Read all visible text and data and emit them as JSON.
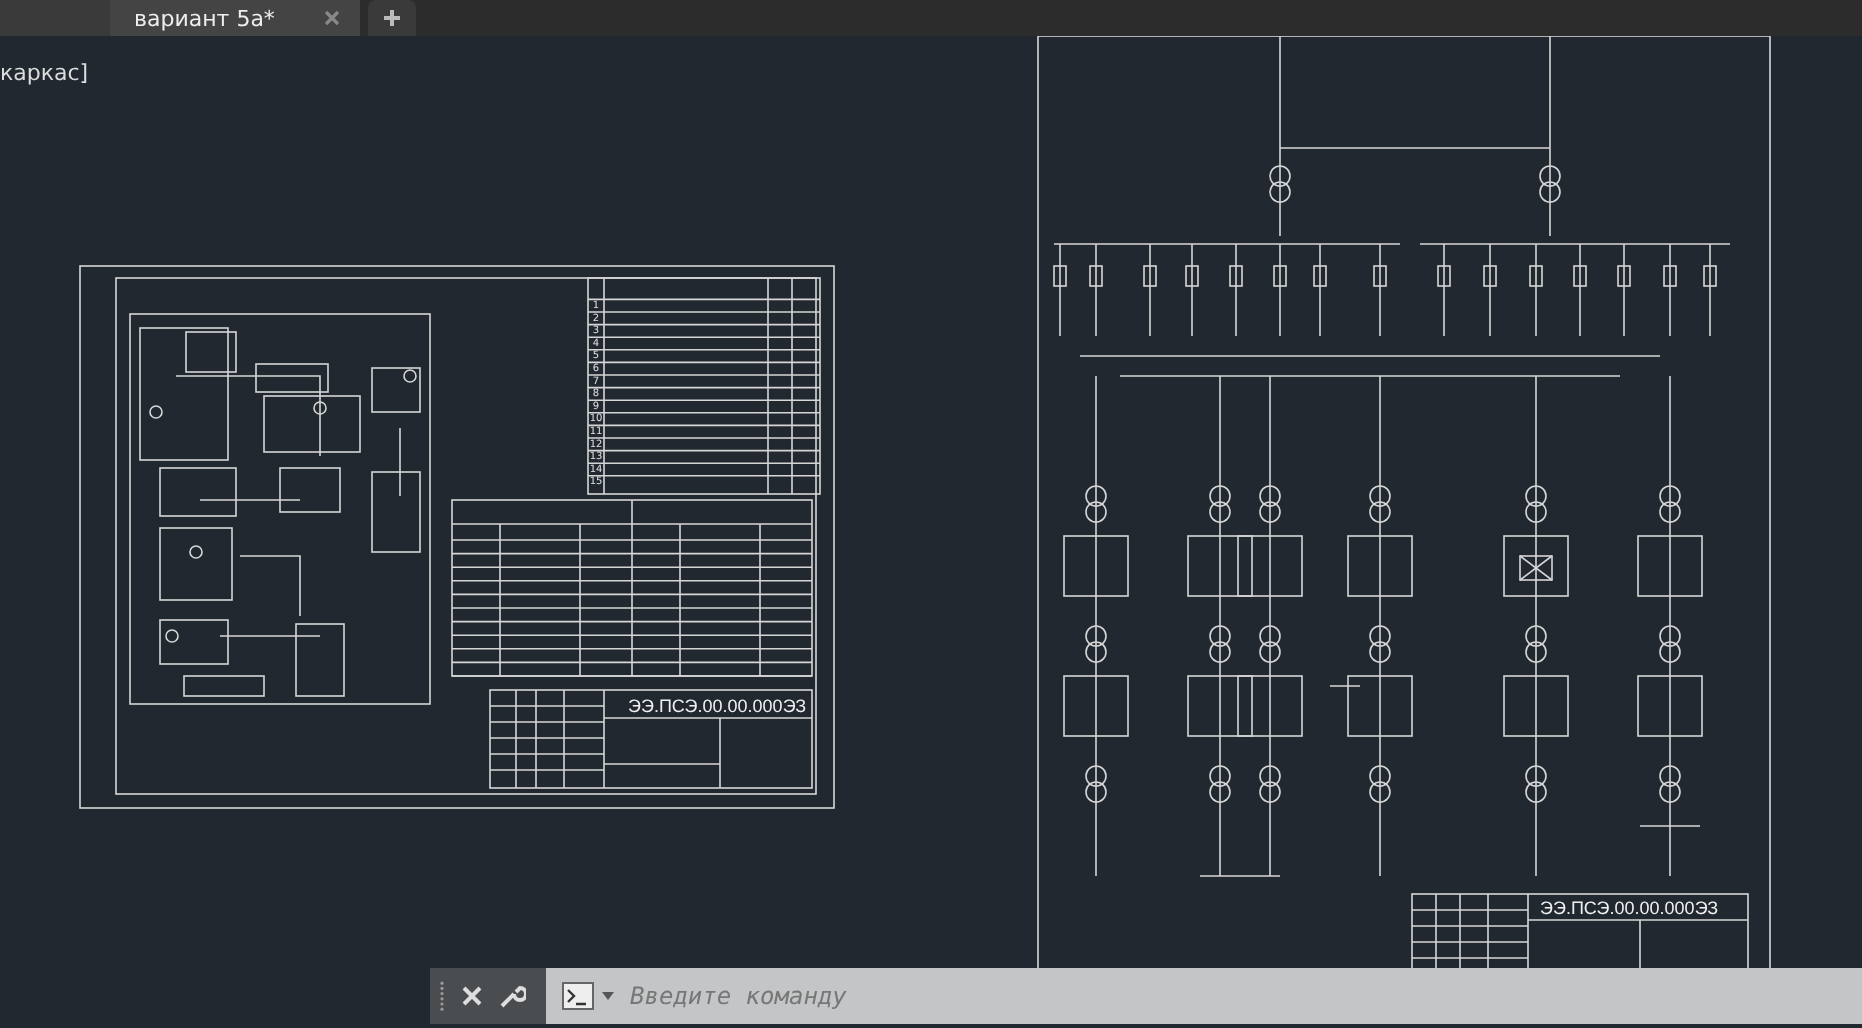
{
  "tabs": [
    {
      "label": "вариант 5а*",
      "selected": true
    }
  ],
  "viewport_label": "каркас]",
  "sheets": [
    {
      "title_code": "ЭЭ.ПСЭ.00.00.000ЭЗ",
      "table_rows": [
        "1",
        "2",
        "3",
        "4",
        "5",
        "6",
        "7",
        "8",
        "9",
        "10",
        "11",
        "12",
        "13",
        "14",
        "15"
      ]
    },
    {
      "title_code": "ЭЭ.ПСЭ.00.00.000ЭЗ"
    }
  ],
  "command_line": {
    "placeholder": "Введите команду"
  }
}
